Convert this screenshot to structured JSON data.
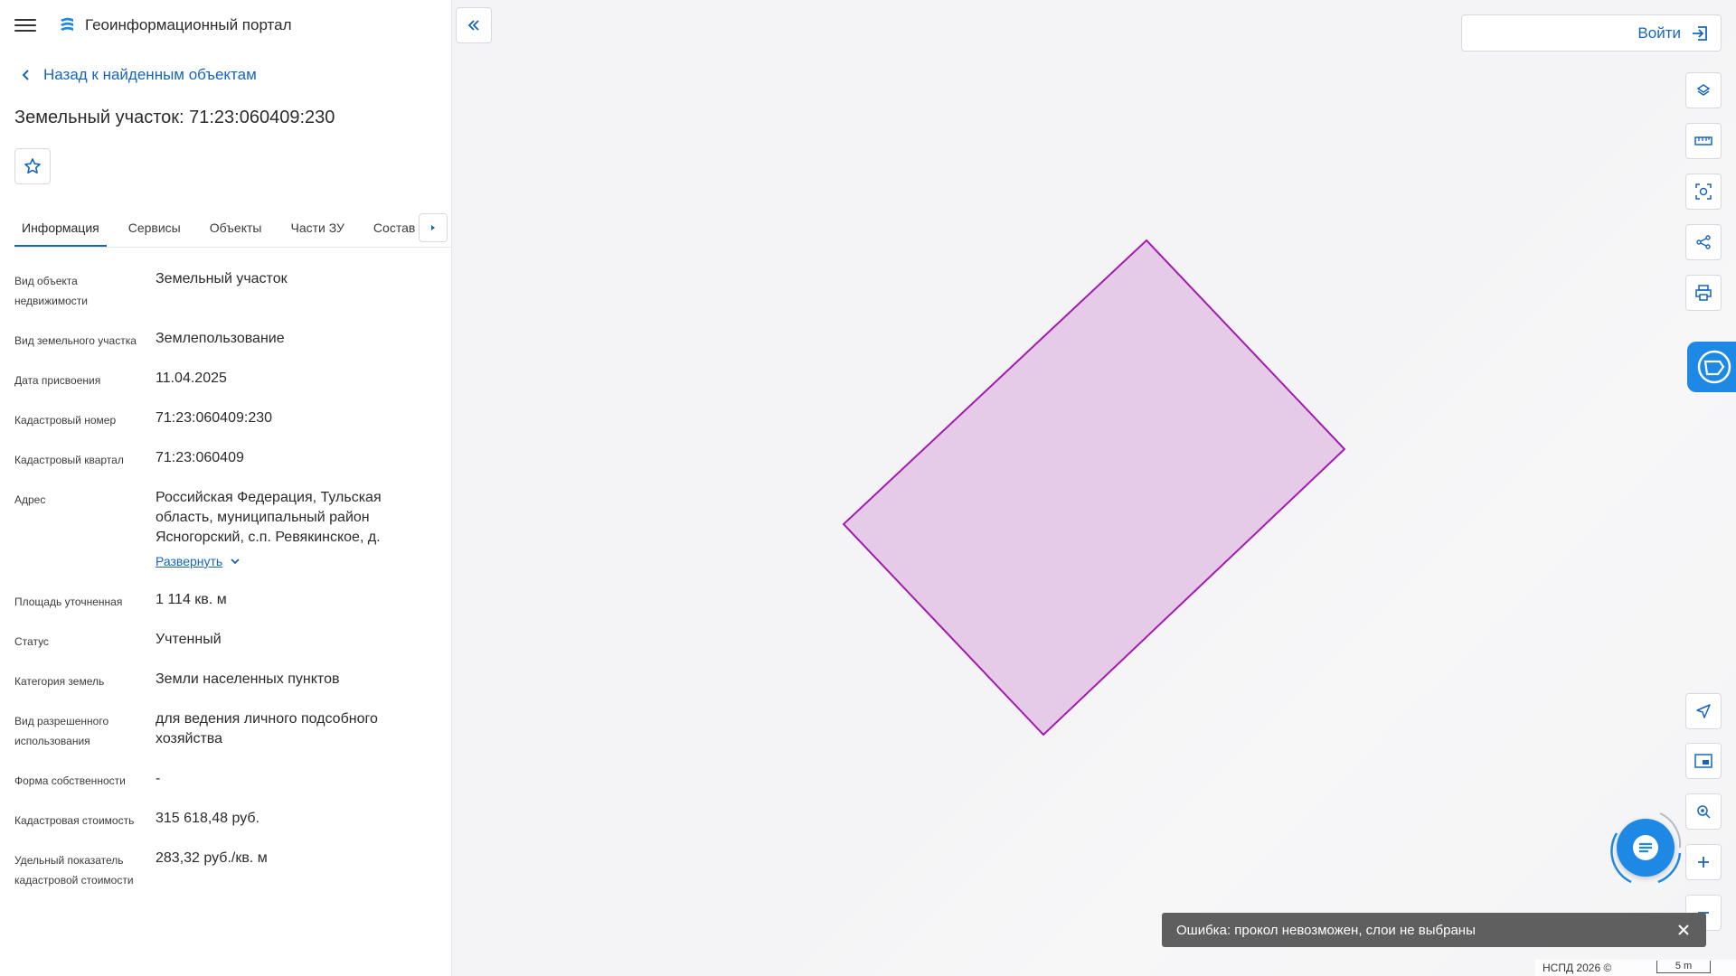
{
  "header": {
    "portal_title": "Геоинформационный портал"
  },
  "back_link": "Назад к найденным объектам",
  "object_title": "Земельный участок: 71:23:060409:230",
  "tabs": [
    {
      "label": "Информация",
      "active": true
    },
    {
      "label": "Сервисы",
      "active": false
    },
    {
      "label": "Объекты",
      "active": false
    },
    {
      "label": "Части ЗУ",
      "active": false
    },
    {
      "label": "Состав",
      "active": false
    }
  ],
  "info_rows": {
    "kind": {
      "label": "Вид объекта недвижимости",
      "value": "Земельный участок"
    },
    "land_kind": {
      "label": "Вид земельного участка",
      "value": "Землепользование"
    },
    "date": {
      "label": "Дата присвоения",
      "value": "11.04.2025"
    },
    "cad_number": {
      "label": "Кадастровый номер",
      "value": "71:23:060409:230"
    },
    "cad_quarter": {
      "label": "Кадастровый квартал",
      "value": "71:23:060409"
    },
    "address": {
      "label": "Адрес",
      "value": "Российская Федерация, Тульская область, муниципальный район Ясногорский, с.п. Ревякинское, д.",
      "expand_label": "Развернуть"
    },
    "area": {
      "label": "Площадь уточненная",
      "value": "1 114 кв. м"
    },
    "status": {
      "label": "Статус",
      "value": "Учтенный"
    },
    "category": {
      "label": "Категория земель",
      "value": "Земли населенных пунктов"
    },
    "permitted_use": {
      "label": "Вид разрешенного использования",
      "value": "для ведения личного подсобного хозяйства"
    },
    "ownership": {
      "label": "Форма собственности",
      "value": "-"
    },
    "cad_cost": {
      "label": "Кадастровая стоимость",
      "value": "315 618,48 руб."
    },
    "specific_cost": {
      "label": "Удельный показатель кадастровой стоимости",
      "value": "283,32 руб./кв. м"
    }
  },
  "login_label": "Войти",
  "toolbar_icons": [
    "layers-icon",
    "ruler-icon",
    "area-select-icon",
    "share-icon",
    "print-icon"
  ],
  "bottom_icons": [
    "locate-icon",
    "minimap-icon",
    "geolocation-icon",
    "zoom-in-icon",
    "zoom-out-icon"
  ],
  "toast": {
    "message": "Ошибка: прокол невозможен, слои не выбраны"
  },
  "attribution": "НСПД 2026 ©",
  "scale_label": "5 m",
  "colors": {
    "accent": "#1565c0",
    "brand": "#1e88e5",
    "parcel_fill": "#e6cbe8",
    "parcel_stroke": "#a21caf"
  }
}
